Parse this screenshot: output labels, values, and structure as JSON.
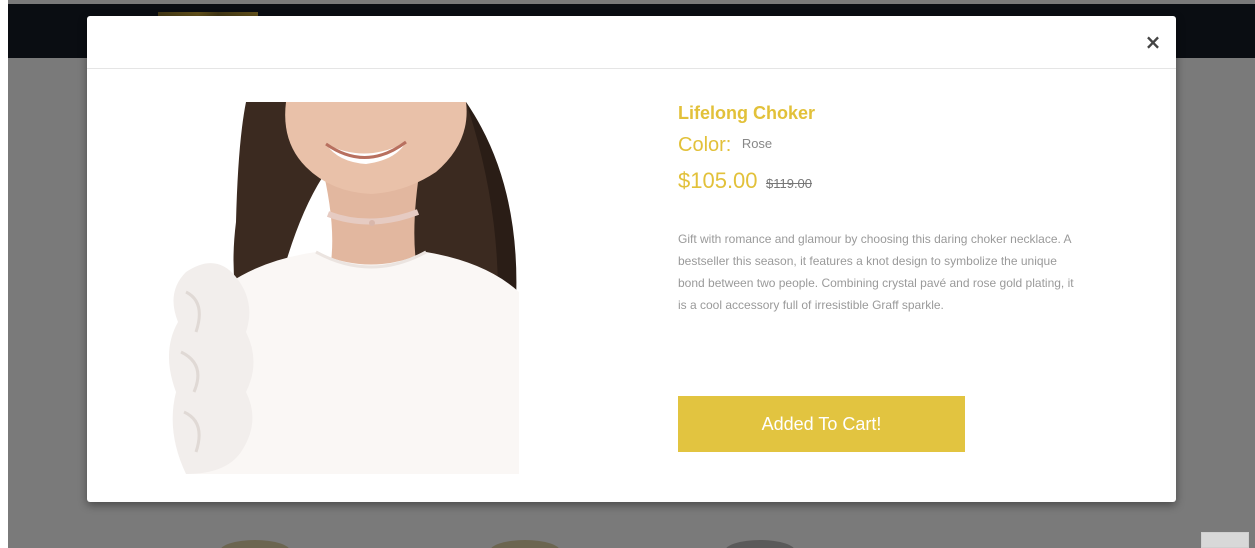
{
  "modal": {
    "close_symbol": "×",
    "image_alt": "Lifelong Choker"
  },
  "product": {
    "name": "Lifelong Choker",
    "color_label": "Color:",
    "color_value": "Rose",
    "price_current": "$105.00",
    "price_old": "$119.00",
    "description": "Gift with romance and glamour by choosing this daring choker necklace. A bestseller this season, it features a knot design to symbolize the unique bond between two people. Combining crystal pavé and rose gold plating, it is a cool accessory full of irresistible Graff sparkle.",
    "cart_button_label": "Added To Cart!"
  },
  "colors": {
    "accent": "#e2c13a",
    "button_bg": "#e2c440",
    "overlay": "#7a7a7a",
    "topbar": "#0a0d12"
  },
  "icons": {
    "close": "close-icon"
  }
}
